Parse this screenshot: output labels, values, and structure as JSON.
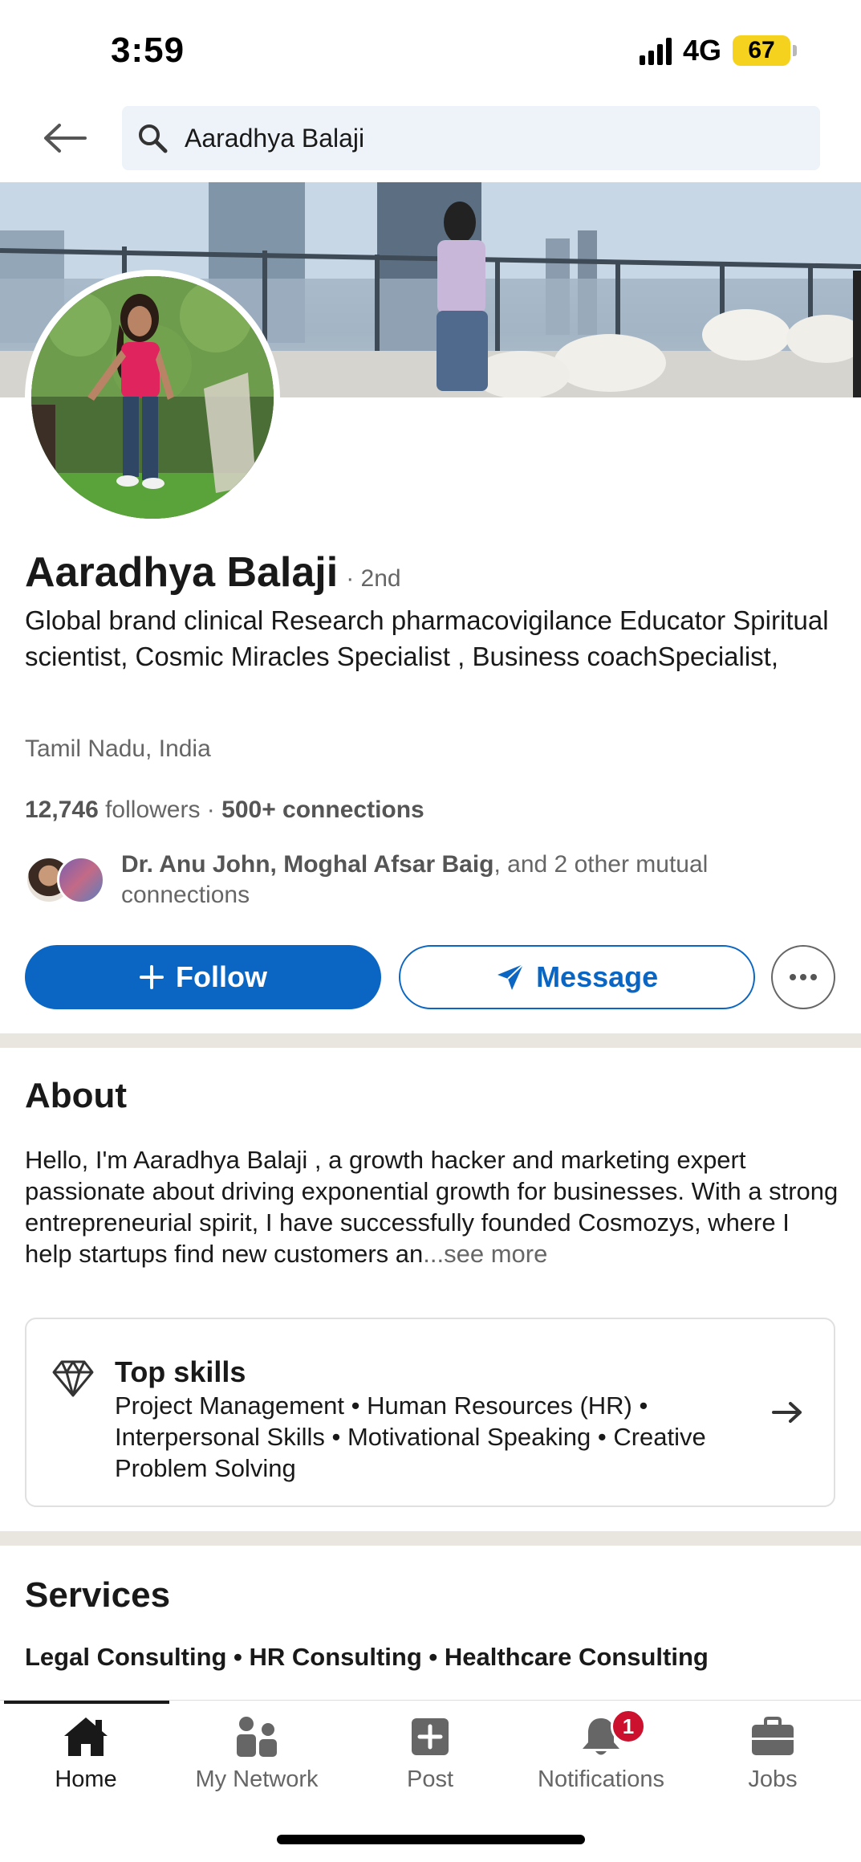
{
  "status_bar": {
    "time": "3:59",
    "network": "4G",
    "battery": "67"
  },
  "search": {
    "query": "Aaradhya Balaji"
  },
  "profile": {
    "name": "Aaradhya Balaji",
    "degree": "· 2nd",
    "headline": "Global brand clinical Research pharmacovigilance Educator Spiritual scientist, Cosmic Miracles Specialist , Business coachSpecialist,",
    "location": "Tamil Nadu, India",
    "followers_count": "12,746",
    "followers_label": " followers · ",
    "connections": "500+ connections",
    "mutual_names": "Dr. Anu John, Moghal Afsar Baig",
    "mutual_suffix": ", and 2 other mutual connections"
  },
  "actions": {
    "follow_label": "Follow",
    "message_label": "Message"
  },
  "about": {
    "title": "About",
    "text": "Hello, I'm Aaradhya Balaji , a growth hacker and marketing expert passionate about driving exponential growth for businesses. With a strong entrepreneurial spirit, I have successfully founded Cosmozys, where I help startups find new customers an",
    "see_more": "...see more"
  },
  "top_skills": {
    "title": "Top skills",
    "list": "Project Management • Human Resources (HR) • Interpersonal Skills • Motivational Speaking • Creative Problem Solving"
  },
  "services": {
    "title": "Services",
    "list": "Legal Consulting • HR Consulting • Healthcare Consulting"
  },
  "bottom_nav": {
    "items": [
      {
        "label": "Home",
        "icon": "home-icon"
      },
      {
        "label": "My Network",
        "icon": "network-icon"
      },
      {
        "label": "Post",
        "icon": "post-icon"
      },
      {
        "label": "Notifications",
        "icon": "bell-icon",
        "badge": "1"
      },
      {
        "label": "Jobs",
        "icon": "briefcase-icon"
      }
    ]
  },
  "colors": {
    "primary": "#0a66c2",
    "badge": "#cb112d",
    "battery": "#f5d21e",
    "divider": "#e9e5df"
  }
}
